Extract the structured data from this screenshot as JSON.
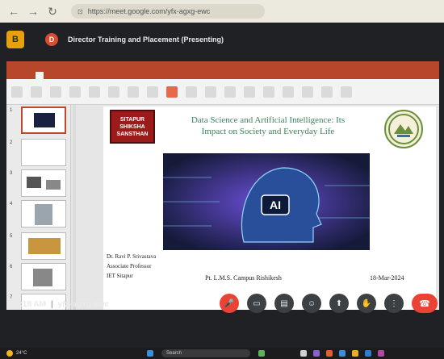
{
  "browser": {
    "url": "https://meet.google.com/yfx-agxg-ewc",
    "back_icon": "arrow-left-icon",
    "forward_icon": "arrow-right-icon",
    "reload_icon": "reload-icon"
  },
  "meet": {
    "presenting_badge": "B",
    "presenter_initial": "D",
    "presenter_label": "Director Training and Placement (Presenting)",
    "time": "11:18 AM",
    "meeting_code": "yfx-agxg-ewc",
    "controls": [
      {
        "name": "mic-off-button",
        "icon": "mic-off-icon",
        "glyph": "🎤",
        "color": "#ea4335"
      },
      {
        "name": "camera-button",
        "icon": "camera-icon",
        "glyph": "▭",
        "color": "#3c4043"
      },
      {
        "name": "captions-button",
        "icon": "captions-icon",
        "glyph": "▤",
        "color": "#3c4043"
      },
      {
        "name": "emoji-button",
        "icon": "emoji-icon",
        "glyph": "☺",
        "color": "#3c4043"
      },
      {
        "name": "present-button",
        "icon": "present-icon",
        "glyph": "⬆",
        "color": "#3c4043"
      },
      {
        "name": "raise-hand-button",
        "icon": "hand-icon",
        "glyph": "✋",
        "color": "#3c4043"
      },
      {
        "name": "more-options-button",
        "icon": "more-vert-icon",
        "glyph": "⋮",
        "color": "#3c4043"
      }
    ],
    "end_call_icon": "phone-hangup-icon",
    "end_call_glyph": "☎"
  },
  "slide": {
    "logo_lines": [
      "SITAPUR",
      "SHIKSHA",
      "SANSTHAN"
    ],
    "title_line1": "Data Science and Artificial Intelligence: Its",
    "title_line2": "Impact on Society and Everyday Life",
    "ai_label": "AI",
    "presenter_name": "Dr. Ravi P. Srivastava",
    "presenter_title": "Associate Professor",
    "presenter_org": "IET Sitapur",
    "campus": "Pt. L.M.S. Campus Rishikesh",
    "date": "18-Mar-2024"
  },
  "thumbnails": [
    "1",
    "2",
    "3",
    "4",
    "5",
    "6",
    "7"
  ],
  "taskbar": {
    "temperature": "24°C",
    "search_placeholder": "Search"
  },
  "colors": {
    "meet_bg": "#202124",
    "ppt_accent": "#b7472a",
    "end_call": "#ea4335",
    "title_green": "#2a8c5a",
    "logo_red": "#9b1b1b"
  }
}
